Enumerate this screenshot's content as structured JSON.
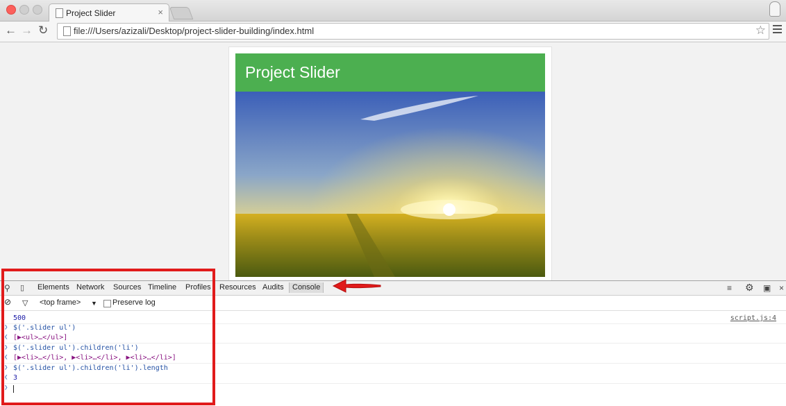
{
  "browser": {
    "tab_title": "Project Slider",
    "tab_close": "×",
    "url": "file:///Users/azizali/Desktop/project-slider-building/index.html",
    "star_icon": "star-icon"
  },
  "page": {
    "header_title": "Project Slider",
    "header_color": "#4caf50"
  },
  "devtools": {
    "tabs": [
      "Elements",
      "Network",
      "Sources",
      "Timeline",
      "Profiles",
      "Resources",
      "Audits",
      "Console"
    ],
    "active_tab": "Console",
    "frame_select": "<top frame>",
    "preserve_log_label": "Preserve log",
    "console": {
      "lines": [
        {
          "kind": "output",
          "text": "500",
          "source": "script.js:4"
        },
        {
          "kind": "input",
          "text": "$('.slider ul')"
        },
        {
          "kind": "output",
          "text": "[▶<ul>…</ul>]"
        },
        {
          "kind": "input",
          "text": "$('.slider ul').children('li')"
        },
        {
          "kind": "output",
          "text": "[▶<li>…</li>, ▶<li>…</li>, ▶<li>…</li>]"
        },
        {
          "kind": "input",
          "text": "$('.slider ul').children('li').length"
        },
        {
          "kind": "output",
          "text": "3"
        }
      ]
    }
  },
  "annotation": {
    "highlight_color": "#e11b1b"
  }
}
